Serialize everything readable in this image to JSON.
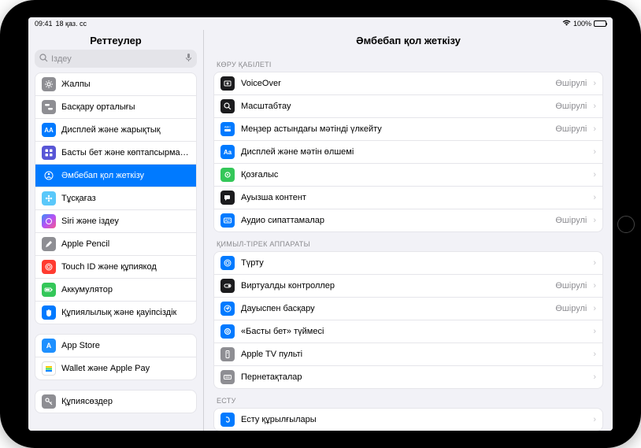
{
  "status": {
    "time": "09:41",
    "date": "18 қаз. сс",
    "battery": "100%"
  },
  "sidebar": {
    "title": "Реттеулер",
    "search_placeholder": "Іздеу",
    "groups": [
      {
        "items": [
          {
            "label": "Жалпы",
            "icon": "gear",
            "color": "ic-gray"
          },
          {
            "label": "Басқару орталығы",
            "icon": "switches",
            "color": "ic-gray"
          },
          {
            "label": "Дисплей және жарықтық",
            "icon": "AA",
            "color": "ic-blue"
          },
          {
            "label": "Басты бет және көптапсырмал…",
            "icon": "grid",
            "color": "ic-purple"
          },
          {
            "label": "Әмбебап қол жеткізу",
            "icon": "person",
            "color": "ic-blue",
            "selected": true
          },
          {
            "label": "Тұсқағаз",
            "icon": "flower",
            "color": "ic-teal"
          },
          {
            "label": "Siri және іздеу",
            "icon": "siri",
            "color": "ic-siri"
          },
          {
            "label": "Apple Pencil",
            "icon": "pencil",
            "color": "ic-gray"
          },
          {
            "label": "Touch ID және құпиякод",
            "icon": "touch",
            "color": "ic-red"
          },
          {
            "label": "Аккумулятор",
            "icon": "battery",
            "color": "ic-green"
          },
          {
            "label": "Құпиялылық және қауіпсіздік",
            "icon": "hand",
            "color": "ic-blue"
          }
        ]
      },
      {
        "items": [
          {
            "label": "App Store",
            "icon": "A",
            "color": "ic-appstore"
          },
          {
            "label": "Wallet және Apple Pay",
            "icon": "wallet",
            "color": "ic-wallet"
          }
        ]
      },
      {
        "items": [
          {
            "label": "Құпиясөздер",
            "icon": "key",
            "color": "ic-gray"
          }
        ]
      }
    ]
  },
  "detail": {
    "title": "Әмбебап қол жеткізу",
    "sections": [
      {
        "header": "КӨРУ ҚАБІЛЕТІ",
        "rows": [
          {
            "label": "VoiceOver",
            "value": "Өшірулі",
            "icon": "vo",
            "color": "ic-black"
          },
          {
            "label": "Масштабтау",
            "value": "Өшірулі",
            "icon": "zoom",
            "color": "ic-black"
          },
          {
            "label": "Меңзер астындағы мәтінді үлкейту",
            "value": "Өшірулі",
            "icon": "hover",
            "color": "ic-blue"
          },
          {
            "label": "Дисплей және мәтін өлшемі",
            "value": "",
            "icon": "Aa",
            "color": "ic-blue"
          },
          {
            "label": "Қозғалыс",
            "value": "",
            "icon": "motion",
            "color": "ic-green"
          },
          {
            "label": "Ауызша контент",
            "value": "",
            "icon": "speech",
            "color": "ic-black"
          },
          {
            "label": "Аудио сипаттамалар",
            "value": "Өшірулі",
            "icon": "ad",
            "color": "ic-blue"
          }
        ]
      },
      {
        "header": "ҚИМЫЛ-ТІРЕК АППАРАТЫ",
        "rows": [
          {
            "label": "Түрту",
            "value": "",
            "icon": "touch",
            "color": "ic-blue"
          },
          {
            "label": "Виртуалды контроллер",
            "value": "Өшірулі",
            "icon": "switch",
            "color": "ic-black"
          },
          {
            "label": "Дауыспен басқару",
            "value": "Өшірулі",
            "icon": "voice",
            "color": "ic-blue"
          },
          {
            "label": "«Басты бет» түймесі",
            "value": "",
            "icon": "home",
            "color": "ic-blue"
          },
          {
            "label": "Apple TV пульті",
            "value": "",
            "icon": "remote",
            "color": "ic-gray"
          },
          {
            "label": "Пернетақталар",
            "value": "",
            "icon": "kb",
            "color": "ic-gray"
          }
        ]
      },
      {
        "header": "ЕСТУ",
        "rows": [
          {
            "label": "Есту құрылғылары",
            "value": "",
            "icon": "ear",
            "color": "ic-blue"
          }
        ]
      }
    ]
  }
}
